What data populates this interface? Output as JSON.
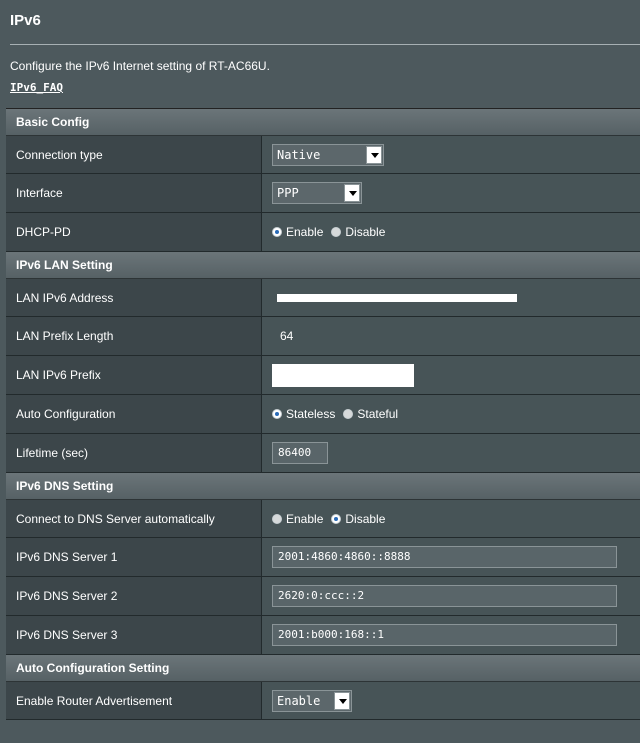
{
  "page": {
    "title": "IPv6",
    "description": "Configure the IPv6 Internet setting of RT-AC66U.",
    "faq_link": "IPv6_FAQ"
  },
  "basic_config": {
    "header": "Basic Config",
    "connection_type": {
      "label": "Connection type",
      "value": "Native"
    },
    "interface": {
      "label": "Interface",
      "value": "PPP"
    },
    "dhcp_pd": {
      "label": "DHCP-PD",
      "enable_label": "Enable",
      "disable_label": "Disable",
      "selected": "Enable"
    }
  },
  "lan_setting": {
    "header": "IPv6 LAN Setting",
    "lan_ipv6_address": {
      "label": "LAN IPv6 Address"
    },
    "lan_prefix_length": {
      "label": "LAN Prefix Length",
      "value": "64"
    },
    "lan_ipv6_prefix": {
      "label": "LAN IPv6 Prefix"
    },
    "auto_configuration": {
      "label": "Auto Configuration",
      "stateless_label": "Stateless",
      "stateful_label": "Stateful",
      "selected": "Stateless"
    },
    "lifetime": {
      "label": "Lifetime (sec)",
      "value": "86400"
    }
  },
  "dns_setting": {
    "header": "IPv6 DNS Setting",
    "auto_dns": {
      "label": "Connect to DNS Server automatically",
      "enable_label": "Enable",
      "disable_label": "Disable",
      "selected": "Disable"
    },
    "dns1": {
      "label": "IPv6 DNS Server 1",
      "value": "2001:4860:4860::8888"
    },
    "dns2": {
      "label": "IPv6 DNS Server 2",
      "value": "2620:0:ccc::2"
    },
    "dns3": {
      "label": "IPv6 DNS Server 3",
      "value": "2001:b000:168::1"
    }
  },
  "auto_config_setting": {
    "header": "Auto Configuration Setting",
    "router_advertisement": {
      "label": "Enable Router Advertisement",
      "value": "Enable"
    }
  }
}
